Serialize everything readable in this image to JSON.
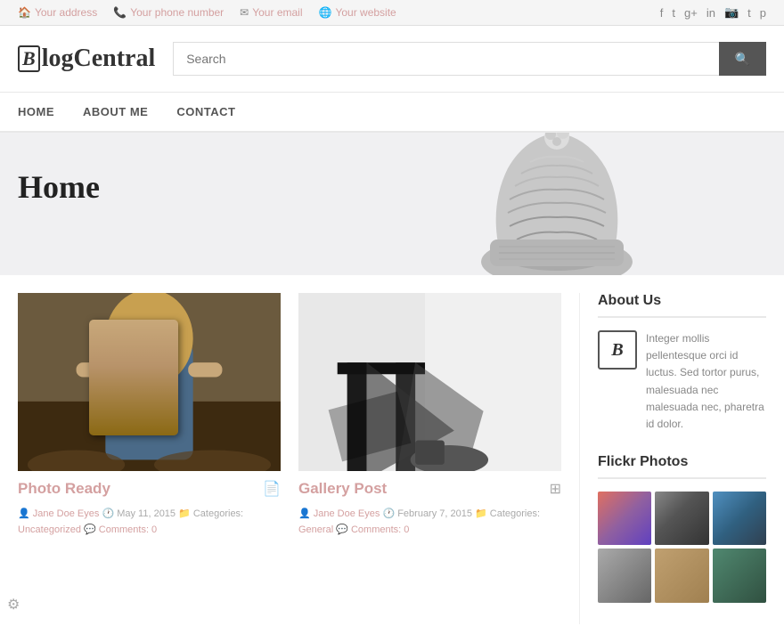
{
  "topbar": {
    "address_icon": "🏠",
    "address": "Your address",
    "phone_icon": "📞",
    "phone": "Your phone number",
    "email_icon": "✉",
    "email": "Your email",
    "web_icon": "🌐",
    "website": "Your website",
    "social_links": [
      {
        "label": "Facebook",
        "icon": "f"
      },
      {
        "label": "Twitter",
        "icon": "t"
      },
      {
        "label": "Google+",
        "icon": "g+"
      },
      {
        "label": "LinkedIn",
        "icon": "in"
      },
      {
        "label": "Instagram",
        "icon": "📷"
      },
      {
        "label": "Tumblr",
        "icon": "t"
      },
      {
        "label": "Pinterest",
        "icon": "p"
      }
    ]
  },
  "header": {
    "logo_text": "BlogCentral",
    "logo_letter": "B",
    "search_placeholder": "Search"
  },
  "nav": {
    "items": [
      {
        "label": "HOME",
        "href": "#"
      },
      {
        "label": "ABOUT ME",
        "href": "#"
      },
      {
        "label": "CONTACT",
        "href": "#"
      }
    ]
  },
  "hero": {
    "title": "Home"
  },
  "posts": [
    {
      "title": "Photo Ready",
      "author": "Jane Doe Eyes",
      "date": "May 11, 2015",
      "categories": "Uncategorized",
      "comments": "Comments: 0",
      "icon": "📄"
    },
    {
      "title": "Gallery Post",
      "author": "Jane Doe Eyes",
      "date": "February 7, 2015",
      "categories": "General",
      "comments": "Comments: 0",
      "icon": "⊞"
    }
  ],
  "sidebar": {
    "about_heading": "About Us",
    "about_text": "Integer mollis pellentesque orci id luctus. Sed tortor purus, malesuada nec malesuada nec, pharetra id dolor.",
    "flickr_heading": "Flickr Photos"
  }
}
